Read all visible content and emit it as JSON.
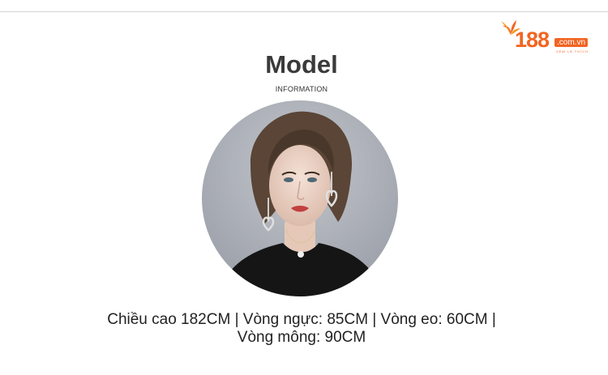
{
  "logo": {
    "digits": "188",
    "domain": ".com.vn",
    "tagline": "XEM LÀ THÍCH",
    "icon": "orange-leaf-icon",
    "brand_color": "#f26522"
  },
  "header": {
    "title": "Model",
    "subtitle": "INFORMATION"
  },
  "portrait": {
    "description_icon": "model-portrait-photo",
    "background_color": "#a9adb5"
  },
  "measurements": {
    "line1": "Chiều cao 182CM | Vòng ngực: 85CM | Vòng eo: 60CM |",
    "line2": "Vòng mông: 90CM"
  }
}
